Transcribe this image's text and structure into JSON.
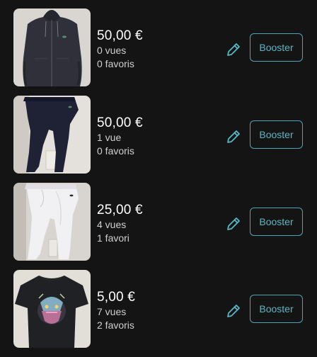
{
  "items": [
    {
      "price": "50,00 €",
      "views": "0 vues",
      "favorites": "0 favoris",
      "booster_label": "Booster",
      "icon": "pencil-icon",
      "photo": "dark-hoodie"
    },
    {
      "price": "50,00 €",
      "views": "1 vue",
      "favorites": "0 favoris",
      "booster_label": "Booster",
      "icon": "pencil-icon",
      "photo": "dark-sweatpants"
    },
    {
      "price": "25,00 €",
      "views": "4 vues",
      "favorites": "1 favori",
      "booster_label": "Booster",
      "icon": "pencil-icon",
      "photo": "white-sweatpants"
    },
    {
      "price": "5,00 €",
      "views": "7 vues",
      "favorites": "2 favoris",
      "booster_label": "Booster",
      "icon": "pencil-icon",
      "photo": "black-tshirt-tiger"
    }
  ],
  "colors": {
    "background": "#141414",
    "accent": "#4fa4b3",
    "text": "#f2f2f2",
    "secondary_text": "#cfcfcf"
  }
}
